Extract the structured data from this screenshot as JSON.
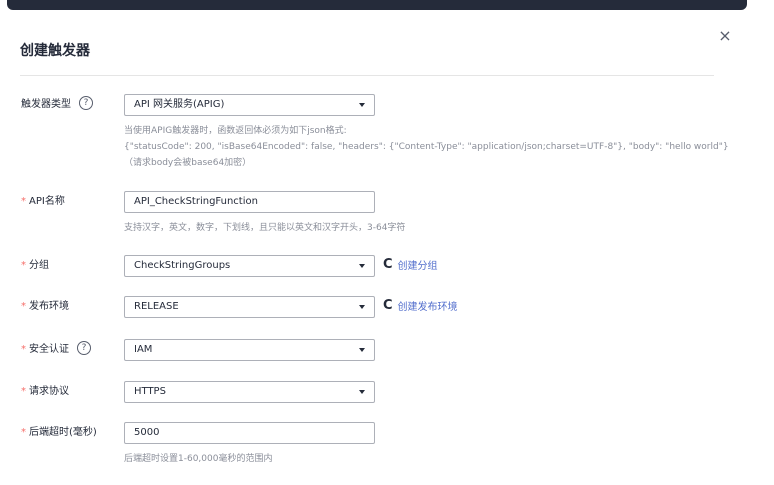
{
  "dialog": {
    "title": "创建触发器",
    "close_glyph": "×"
  },
  "form": {
    "trigger_type": {
      "label": "触发器类型",
      "help": "?",
      "value": "API 网关服务(APIG)",
      "hints": [
        "当使用APIG触发器时，函数返回体必须为如下json格式:",
        "{\"statusCode\": 200, \"isBase64Encoded\": false, \"headers\": {\"Content-Type\": \"application/json;charset=UTF-8\"}, \"body\": \"hello world\"}",
        "（请求body会被base64加密）"
      ]
    },
    "api_name": {
      "required": "*",
      "label": "API名称",
      "value": "API_CheckStringFunction",
      "hint": "支持汉字，英文，数字，下划线，且只能以英文和汉字开头，3-64字符"
    },
    "group": {
      "required": "*",
      "label": "分组",
      "value": "CheckStringGroups",
      "refresh_glyph": "C",
      "link": "创建分组"
    },
    "environment": {
      "required": "*",
      "label": "发布环境",
      "value": "RELEASE",
      "refresh_glyph": "C",
      "link": "创建发布环境"
    },
    "auth": {
      "required": "*",
      "label": "安全认证",
      "help": "?",
      "value": "IAM"
    },
    "protocol": {
      "required": "*",
      "label": "请求协议",
      "value": "HTTPS"
    },
    "timeout": {
      "required": "*",
      "label": "后端超时(毫秒)",
      "value": "5000",
      "hint": "后端超时设置1-60,000毫秒的范围内"
    }
  },
  "colors": {
    "required": "#f66f6a",
    "link": "#526ecc",
    "hint": "#8a8e99",
    "topbar": "#252b3a"
  }
}
